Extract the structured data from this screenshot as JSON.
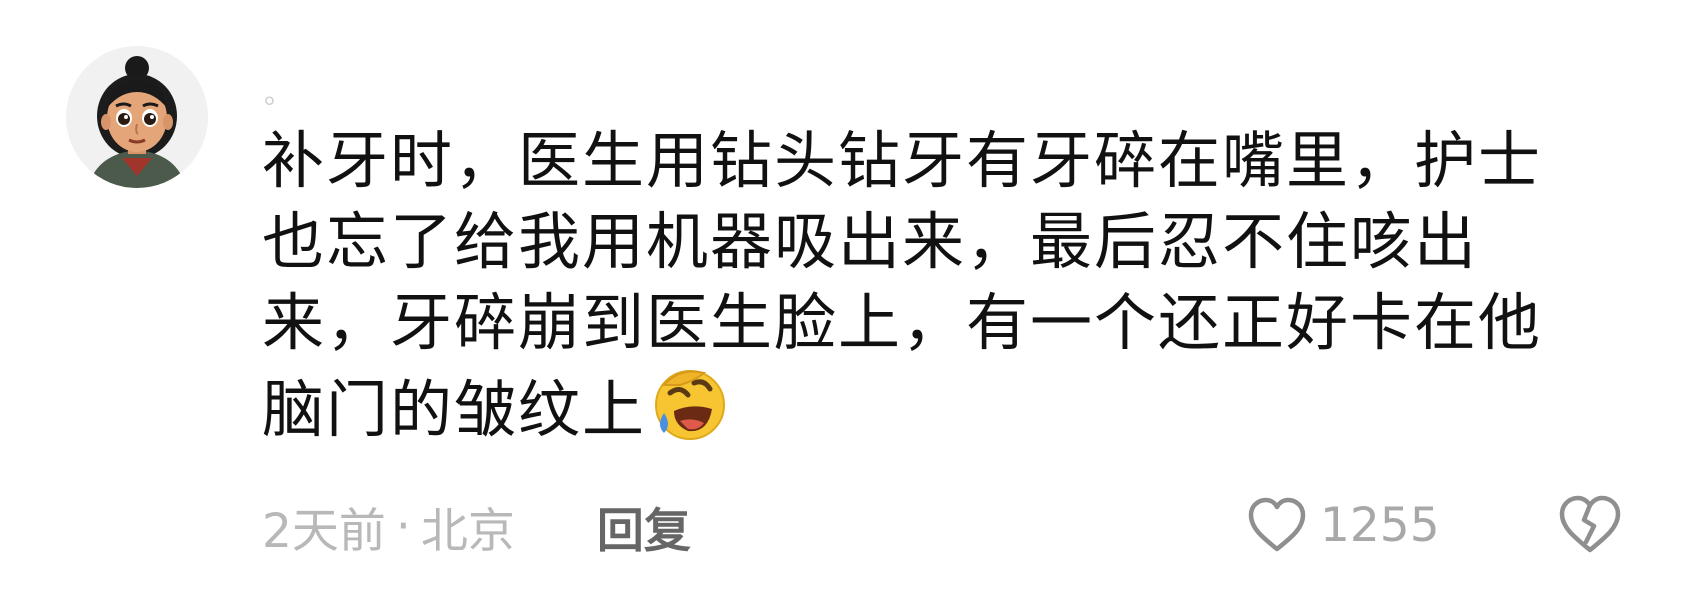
{
  "comment": {
    "avatar_icon": "cartoon-girl-avatar",
    "username_fragment": "。",
    "text": "补牙时，医生用钻头钻牙有牙碎在嘴里，护士也忘了给我用机器吸出来，最后忍不住咳出来，牙碎崩到医生脸上，有一个还正好卡在他脑门的皱纹上",
    "emoji": "rolling-laughing-emoji",
    "time": "2天前",
    "separator": "·",
    "location": "北京",
    "reply_label": "回复",
    "like_icon": "heart-outline-icon",
    "like_count": "1255",
    "dislike_icon": "broken-heart-icon"
  },
  "colors": {
    "text": "#111111",
    "meta": "#b8b8b8",
    "reply": "#666666",
    "icon": "#8f8f8f",
    "emoji_yellow": "#f7c531",
    "emoji_tear": "#4a8fe3"
  }
}
